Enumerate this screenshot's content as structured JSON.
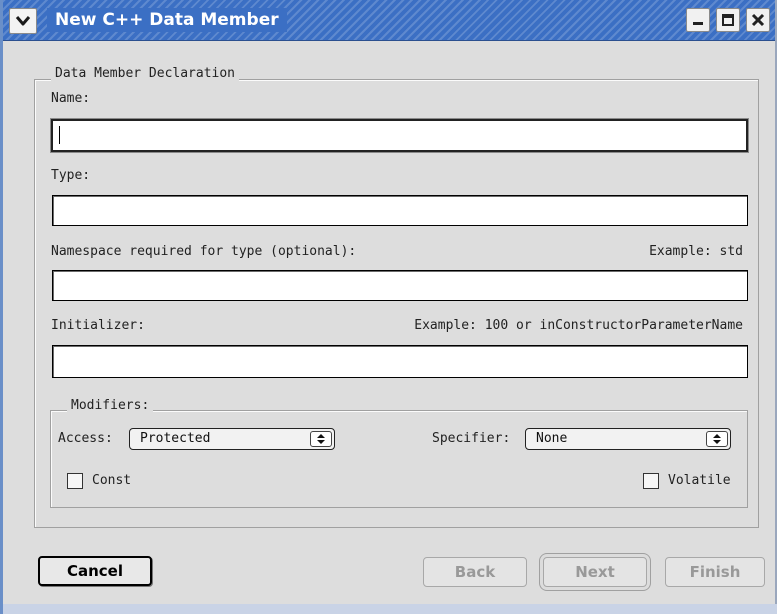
{
  "window": {
    "title": "New C++ Data Member",
    "menu_icon": "chevron-down-icon",
    "controls": [
      "minimize-icon",
      "maximize-icon",
      "close-icon"
    ]
  },
  "declaration": {
    "legend": "Data Member Declaration",
    "name_label": "Name:",
    "name_value": "",
    "type_label": "Type:",
    "type_value": "",
    "namespace_label": "Namespace required for type (optional):",
    "namespace_example": "Example: std",
    "namespace_value": "",
    "initializer_label": "Initializer:",
    "initializer_example": "Example: 100 or inConstructorParameterName",
    "initializer_value": ""
  },
  "modifiers": {
    "legend": "Modifiers:",
    "access_label": "Access:",
    "access_value": "Protected",
    "specifier_label": "Specifier:",
    "specifier_value": "None",
    "const_label": "Const",
    "const_checked": false,
    "volatile_label": "Volatile",
    "volatile_checked": false
  },
  "buttons": {
    "cancel": "Cancel",
    "back": "Back",
    "next": "Next",
    "finish": "Finish"
  }
}
